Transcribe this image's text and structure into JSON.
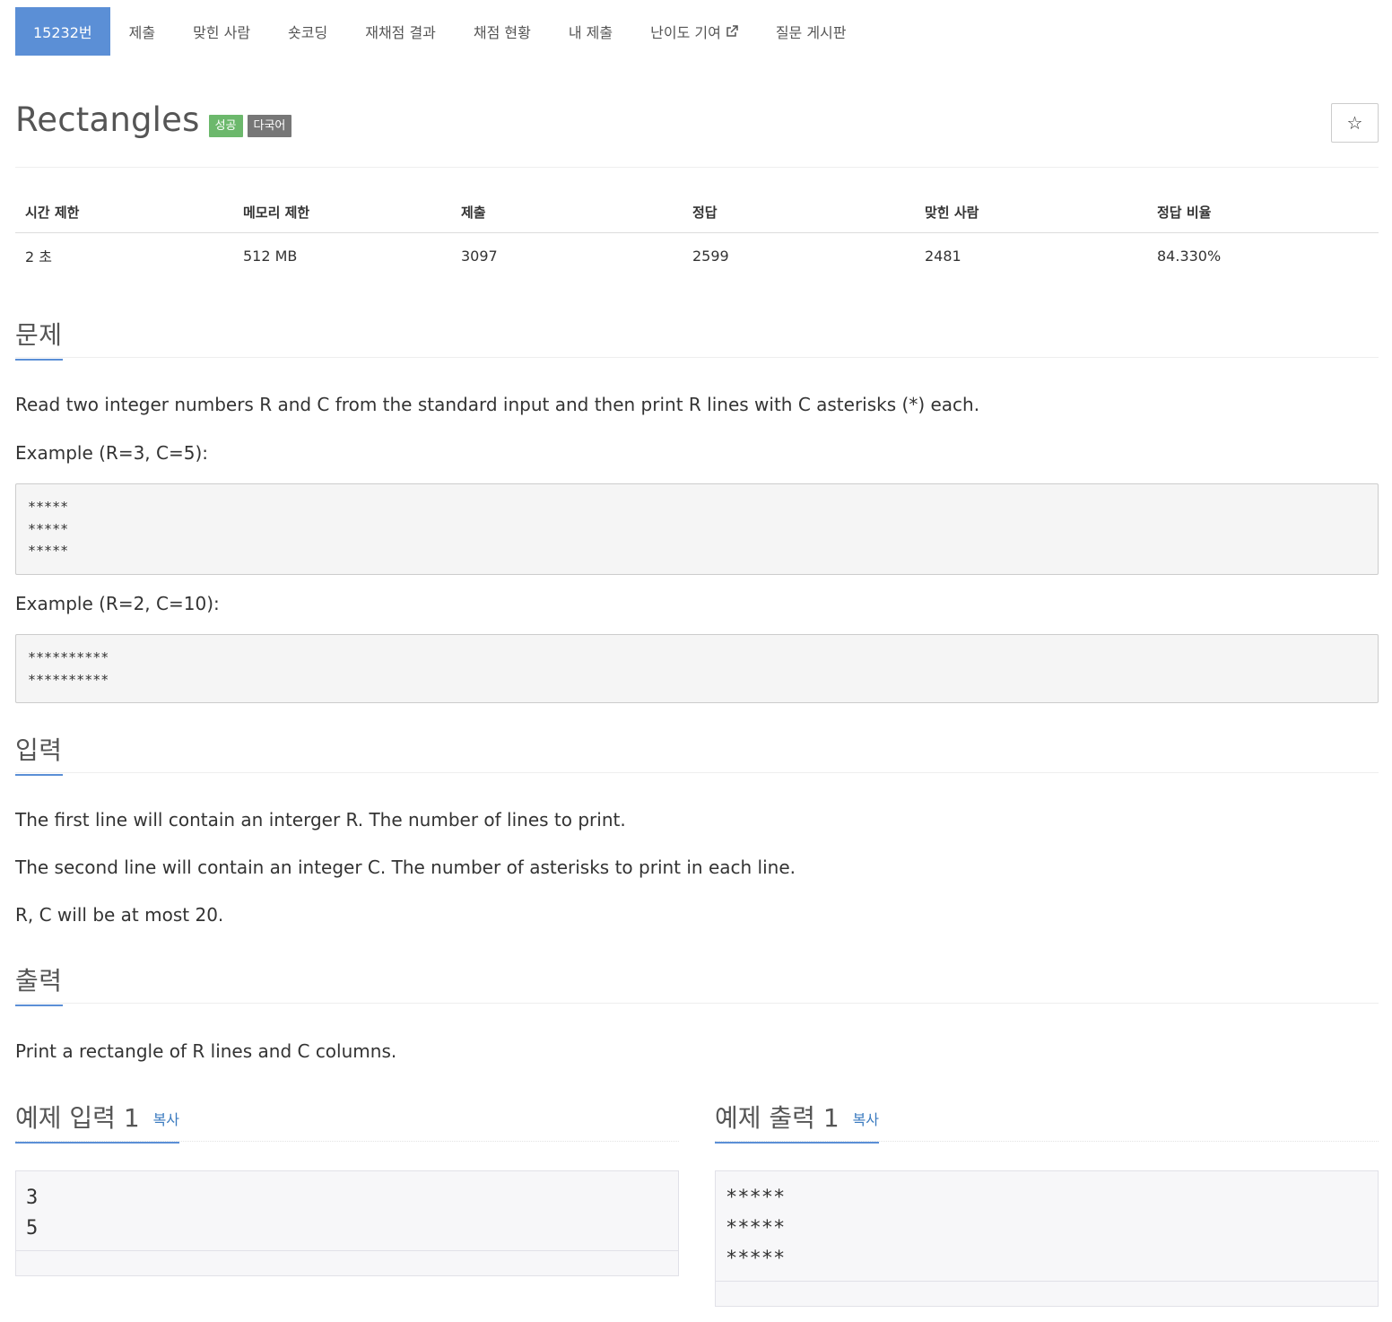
{
  "nav": {
    "problem_id": "15232번",
    "items": [
      "제출",
      "맞힌 사람",
      "숏코딩",
      "재채점 결과",
      "채점 현황",
      "내 제출",
      "난이도 기여",
      "질문 게시판"
    ]
  },
  "header": {
    "title": "Rectangles",
    "badge_success": "성공",
    "badge_lang": "다국어",
    "star": "☆"
  },
  "info": {
    "headers": [
      "시간 제한",
      "메모리 제한",
      "제출",
      "정답",
      "맞힌 사람",
      "정답 비율"
    ],
    "values": [
      "2 초",
      "512 MB",
      "3097",
      "2599",
      "2481",
      "84.330%"
    ]
  },
  "problem": {
    "heading": "문제",
    "intro": "Read two integer numbers R and C from the standard input and then print R lines with C asterisks (*) each.",
    "example1_label": "Example (R=3, C=5):",
    "example1_text": "*****\n*****\n*****",
    "example2_label": "Example (R=2, C=10):",
    "example2_text": "**********\n**********"
  },
  "input": {
    "heading": "입력",
    "lines": [
      "The first line will contain an interger R. The number of lines to print.",
      "The second line will contain an integer C. The number of asterisks to print in each line.",
      "R, C will be at most 20."
    ]
  },
  "output": {
    "heading": "출력",
    "text": "Print a rectangle of R lines and C columns."
  },
  "samples": {
    "input_title": "예제 입력 1",
    "output_title": "예제 출력 1",
    "copy_label": "복사",
    "input_text": "3\n5",
    "output_text": "*****\n*****\n*****"
  }
}
